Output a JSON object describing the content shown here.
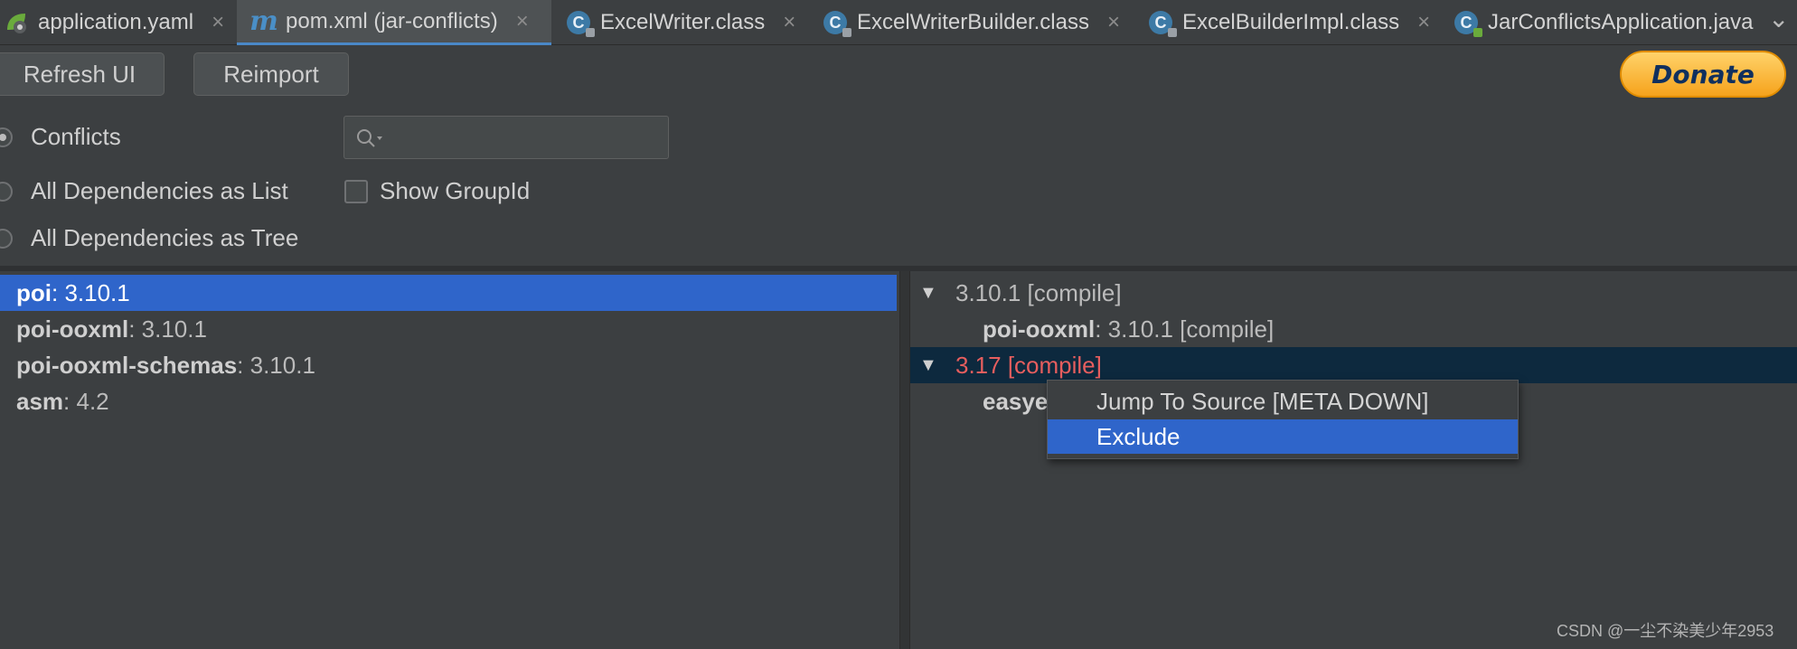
{
  "tabs": [
    {
      "label": "application.yaml",
      "icon": "spring-yaml-icon"
    },
    {
      "label": "pom.xml (jar-conflicts)",
      "icon": "maven-icon",
      "active": true
    },
    {
      "label": "ExcelWriter.class",
      "icon": "class-icon"
    },
    {
      "label": "ExcelWriterBuilder.class",
      "icon": "class-icon"
    },
    {
      "label": "ExcelBuilderImpl.class",
      "icon": "class-icon"
    },
    {
      "label": "JarConflictsApplication.java",
      "icon": "spring-app-icon"
    }
  ],
  "icons": {
    "class": "C",
    "maven": "m",
    "close": "×",
    "overflow": "⌄",
    "triangle": "▼"
  },
  "toolbar": {
    "refresh_label": "Refresh UI",
    "reimport_label": "Reimport",
    "donate_label": "Donate"
  },
  "view": {
    "conflicts_label": "Conflicts",
    "list_label": "All Dependencies as List",
    "tree_label": "All Dependencies as Tree",
    "show_groupid_label": "Show GroupId",
    "search_value": ""
  },
  "left_list": [
    {
      "name": "poi",
      "version": " : 3.10.1",
      "selected": true
    },
    {
      "name": "poi-ooxml",
      "version": " : 3.10.1"
    },
    {
      "name": "poi-ooxml-schemas",
      "version": " : 3.10.1"
    },
    {
      "name": "asm",
      "version": " : 4.2"
    }
  ],
  "right_tree": [
    {
      "label": "3.10.1 [compile]",
      "child_name": "poi-ooxml",
      "child_version": " : 3.10.1 [compile]"
    },
    {
      "label": "3.17 [compile]",
      "child_name": "easye",
      "conflict": true
    }
  ],
  "context_menu": {
    "jump_label": "Jump To Source [META DOWN]",
    "exclude_label": "Exclude"
  },
  "watermark": "CSDN @一尘不染美少年2953",
  "colors": {
    "selection": "#2f65ca",
    "conflict": "#e65e5e",
    "tab_underline": "#4a88c7"
  }
}
